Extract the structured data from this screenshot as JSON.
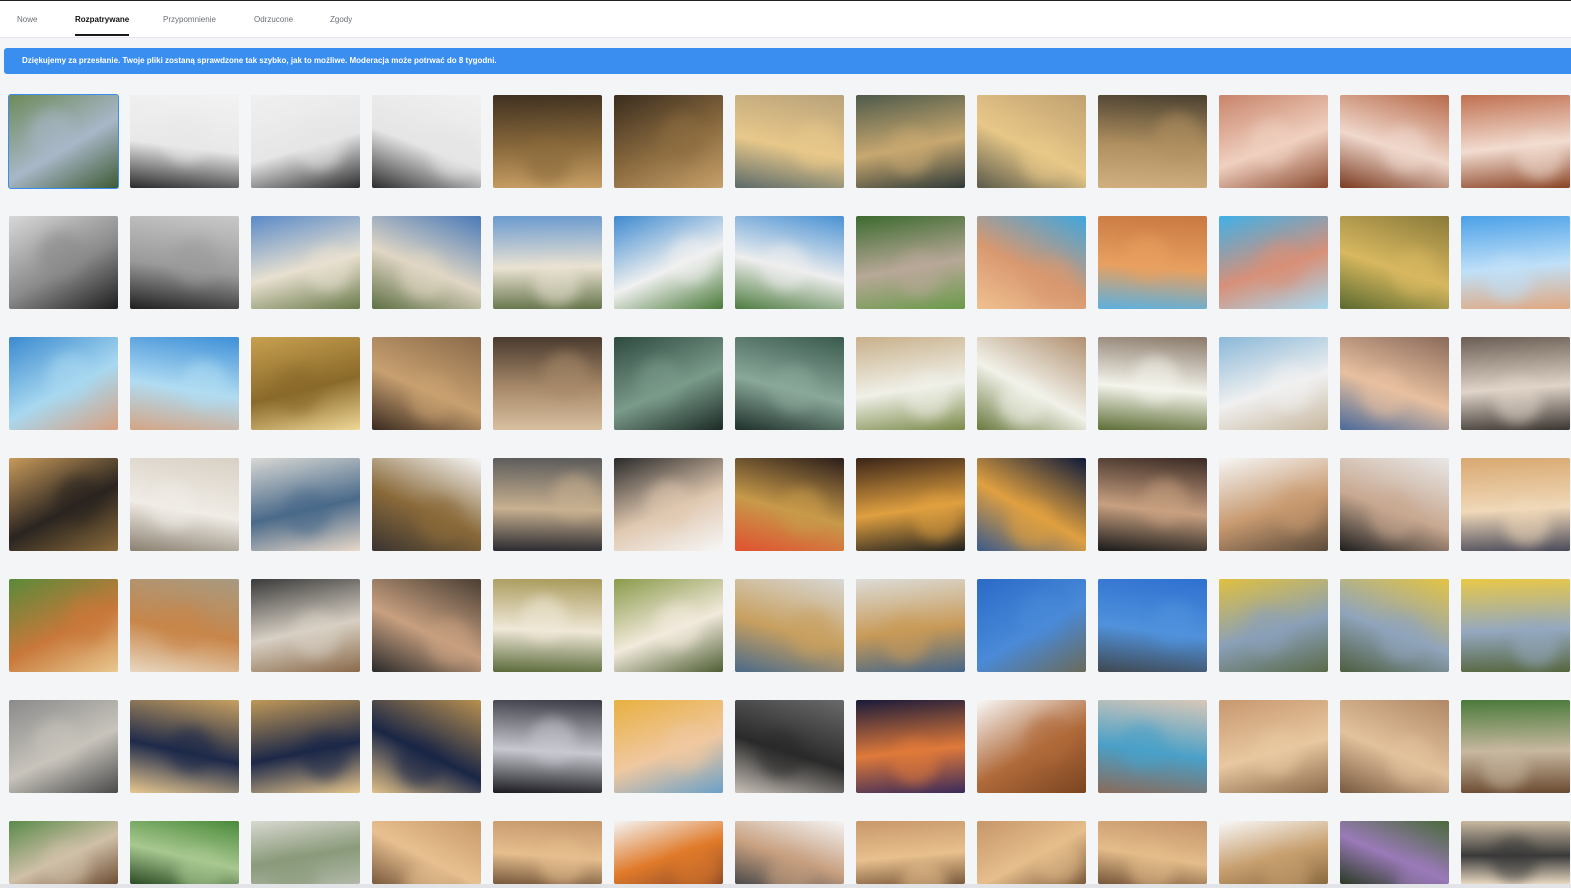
{
  "tabs": [
    {
      "label": "Nowe",
      "active": false
    },
    {
      "label": "Rozpatrywane",
      "active": true
    },
    {
      "label": "Przypomnienie",
      "active": false
    },
    {
      "label": "Odrzucone",
      "active": false
    },
    {
      "label": "Zgody",
      "active": false
    }
  ],
  "banner": {
    "text": "Dziękujemy za przesłanie. Twoje pliki zostaną sprawdzone tak szybko, jak to możliwe. Moderacja może potrwać do 8 tygodni.",
    "color": "#3a8ef0"
  },
  "selected_index": 0,
  "thumbnails": [
    {
      "subject": "older man drinking water in garden",
      "colors": [
        "#6e8a5a",
        "#a8b7c8",
        "#3d5a34"
      ]
    },
    {
      "subject": "older man in white t-shirt",
      "colors": [
        "#f2f2f2",
        "#e8e8e8",
        "#2a2a2a"
      ]
    },
    {
      "subject": "older man in white t-shirt",
      "colors": [
        "#f0f0f0",
        "#e6e6e6",
        "#2b2b2b"
      ]
    },
    {
      "subject": "older man in white t-shirt",
      "colors": [
        "#f1f1f1",
        "#e5e5e5",
        "#2c2c2c"
      ]
    },
    {
      "subject": "child planting seedling",
      "colors": [
        "#3f3020",
        "#8a6a3c",
        "#c9a066"
      ]
    },
    {
      "subject": "child planting seedling",
      "colors": [
        "#3a2c1e",
        "#8c6c40",
        "#c7a06a"
      ]
    },
    {
      "subject": "holding hands at sunset",
      "colors": [
        "#b9a27a",
        "#e8c88a",
        "#5a6a6a"
      ]
    },
    {
      "subject": "holding hands at sunset",
      "colors": [
        "#4e5a4a",
        "#c8a870",
        "#2e3a38"
      ]
    },
    {
      "subject": "holding hands at sunset",
      "colors": [
        "#c0a070",
        "#e8c888",
        "#5a5a4a"
      ]
    },
    {
      "subject": "holding hands at sunset",
      "colors": [
        "#4a4030",
        "#b09060",
        "#d0b080"
      ]
    },
    {
      "subject": "woman blowing kiss",
      "colors": [
        "#c8846a",
        "#f0d0c0",
        "#8a4a30"
      ]
    },
    {
      "subject": "woman blowing kiss",
      "colors": [
        "#b86a4a",
        "#f0d8cc",
        "#7a3a20"
      ]
    },
    {
      "subject": "woman blowing kiss",
      "colors": [
        "#c07050",
        "#f2dcd0",
        "#8a4426"
      ]
    },
    {
      "subject": "woman in white shirt black and white",
      "colors": [
        "#d8d8d8",
        "#8a8a8a",
        "#1e1e1e"
      ]
    },
    {
      "subject": "woman in white shirt black and white",
      "colors": [
        "#c8c8c8",
        "#9a9a9a",
        "#202020"
      ]
    },
    {
      "subject": "cotton field with flowing fabric",
      "colors": [
        "#5a8ac8",
        "#e8e0d0",
        "#6a7a4a"
      ]
    },
    {
      "subject": "cotton field with flowing fabric",
      "colors": [
        "#4a7ab8",
        "#e0d6c4",
        "#5e7044"
      ]
    },
    {
      "subject": "cotton field with flowing fabric",
      "colors": [
        "#6a9ad0",
        "#eae2d2",
        "#64744a"
      ]
    },
    {
      "subject": "hand holding cotton",
      "colors": [
        "#3e8ad0",
        "#f0f0f0",
        "#4a7a3a"
      ]
    },
    {
      "subject": "hand holding cotton",
      "colors": [
        "#4a92d4",
        "#eeeeee",
        "#4e7c40"
      ]
    },
    {
      "subject": "older man drinking water outdoors",
      "colors": [
        "#3c6a2e",
        "#b8a898",
        "#6a9a4a"
      ]
    },
    {
      "subject": "woman drinking from water bottle",
      "colors": [
        "#3ea6e0",
        "#d89870",
        "#f0c090"
      ]
    },
    {
      "subject": "woman drinking from water bottle",
      "colors": [
        "#c87840",
        "#e8a060",
        "#5ab0e0"
      ]
    },
    {
      "subject": "woman drinking from water bottle",
      "colors": [
        "#40b0e8",
        "#d89078",
        "#a8d8f0"
      ]
    },
    {
      "subject": "woman drinking water in field",
      "colors": [
        "#8a7a3a",
        "#d8b860",
        "#5a6a2e"
      ]
    },
    {
      "subject": "water pouring from bottle",
      "colors": [
        "#4aa0e8",
        "#c0e0f8",
        "#e0a880"
      ]
    },
    {
      "subject": "water splash drinking",
      "colors": [
        "#3a8ad0",
        "#a8d8f0",
        "#d8a080"
      ]
    },
    {
      "subject": "water splash drinking",
      "colors": [
        "#3e90d8",
        "#b0dcf2",
        "#d4a484"
      ]
    },
    {
      "subject": "bitcoin coins",
      "colors": [
        "#c8a050",
        "#8a6a2a",
        "#f0d898"
      ]
    },
    {
      "subject": "stressed man at laptop",
      "colors": [
        "#8a6a4a",
        "#c8a070",
        "#3a2a20"
      ]
    },
    {
      "subject": "stressed man at laptop",
      "colors": [
        "#4a3a2e",
        "#a88a6a",
        "#d8c0a0"
      ]
    },
    {
      "subject": "rowing boat on misty lake",
      "colors": [
        "#2e4a40",
        "#7a9a8a",
        "#1a2a24"
      ]
    },
    {
      "subject": "rowing boat on misty lake",
      "colors": [
        "#3a5a4e",
        "#8aa89a",
        "#1e302a"
      ]
    },
    {
      "subject": "child with daisy bouquet",
      "colors": [
        "#c8b08a",
        "#f0f0e8",
        "#7a8a4a"
      ]
    },
    {
      "subject": "child with daisy bouquet",
      "colors": [
        "#b09070",
        "#f2f2ea",
        "#6a7a3e"
      ]
    },
    {
      "subject": "child with daisy bouquet",
      "colors": [
        "#8a7a6a",
        "#f4f4ec",
        "#5e6e36"
      ]
    },
    {
      "subject": "woman with suitcase at airport",
      "colors": [
        "#8ab8d8",
        "#f0f0f0",
        "#c8b8a0"
      ]
    },
    {
      "subject": "smiling teenage girl",
      "colors": [
        "#8a6a5a",
        "#e8c0a0",
        "#4a6a9a"
      ]
    },
    {
      "subject": "woman in cozy sweater",
      "colors": [
        "#6a5e54",
        "#e0d4c8",
        "#3a3430"
      ]
    },
    {
      "subject": "cowgirl at sunset",
      "colors": [
        "#c89a5a",
        "#2a2420",
        "#8a6a3a"
      ]
    },
    {
      "subject": "woman relaxing on sofa",
      "colors": [
        "#d8d0c4",
        "#f0ece6",
        "#8a8070"
      ]
    },
    {
      "subject": "nurse talking with elderly woman",
      "colors": [
        "#d8d8d4",
        "#4a6a8a",
        "#e8d8c8"
      ]
    },
    {
      "subject": "yorkshire terrier with food bowl",
      "colors": [
        "#f6f6f6",
        "#8a6a3a",
        "#3a3430"
      ]
    },
    {
      "subject": "couple hugging at airport",
      "colors": [
        "#5a5a5a",
        "#c8b090",
        "#2a2a30"
      ]
    },
    {
      "subject": "couple with microphone",
      "colors": [
        "#2a2a2a",
        "#e0c8b0",
        "#f6f6f6"
      ]
    },
    {
      "subject": "man laughing in casino",
      "colors": [
        "#2a1e1a",
        "#c89a4a",
        "#e05030"
      ]
    },
    {
      "subject": "man laughing in casino",
      "colors": [
        "#3a2418",
        "#e0a040",
        "#202020"
      ]
    },
    {
      "subject": "couple overlooking city at night",
      "colors": [
        "#0e1a3a",
        "#e0a040",
        "#3a5a8a"
      ]
    },
    {
      "subject": "woman on phone call",
      "colors": [
        "#3a2a24",
        "#c8a080",
        "#1a1a1a"
      ]
    },
    {
      "subject": "smiling woman with backpack",
      "colors": [
        "#f6f6f6",
        "#c89a70",
        "#5a4a3a"
      ]
    },
    {
      "subject": "woman on phone",
      "colors": [
        "#e8e8e8",
        "#c8a890",
        "#1e1e1e"
      ]
    },
    {
      "subject": "smiling girl with earphones",
      "colors": [
        "#d8a870",
        "#f0d8b8",
        "#4a4a5a"
      ]
    },
    {
      "subject": "dog running with tennis ball",
      "colors": [
        "#5a8a3a",
        "#c8783a",
        "#e8c890"
      ]
    },
    {
      "subject": "woman hugging dog",
      "colors": [
        "#a89a80",
        "#c8864a",
        "#e8d8c0"
      ]
    },
    {
      "subject": "cowboy playing guitar on porch",
      "colors": [
        "#3a3a3a",
        "#d8d0c4",
        "#8a6a4a"
      ]
    },
    {
      "subject": "cowboy playing guitar on porch",
      "colors": [
        "#4a3e34",
        "#c8a080",
        "#2a2a2a"
      ]
    },
    {
      "subject": "family sitting in meadow",
      "colors": [
        "#a89a5a",
        "#f0e8d8",
        "#5a6a3a"
      ]
    },
    {
      "subject": "family sitting in meadow",
      "colors": [
        "#8a9a4a",
        "#f2eadc",
        "#4e5e34"
      ]
    },
    {
      "subject": "vet examining dog",
      "colors": [
        "#d8d8d4",
        "#c8a060",
        "#4a6a8a"
      ]
    },
    {
      "subject": "vet examining dog",
      "colors": [
        "#dcdcd8",
        "#c89a58",
        "#466688"
      ]
    },
    {
      "subject": "technician on tower",
      "colors": [
        "#2a6ac8",
        "#4a8ad8",
        "#6a6a5a"
      ]
    },
    {
      "subject": "technician on tower",
      "colors": [
        "#2e70d0",
        "#5092dc",
        "#404850"
      ]
    },
    {
      "subject": "woman sitting among tulips",
      "colors": [
        "#e0c040",
        "#8aa0b8",
        "#5a6a4a"
      ]
    },
    {
      "subject": "woman sitting among tulips",
      "colors": [
        "#e4c444",
        "#90a4bc",
        "#4e5e40"
      ]
    },
    {
      "subject": "woman sitting among tulips",
      "colors": [
        "#e8c848",
        "#94a8c0",
        "#56663e"
      ]
    },
    {
      "subject": "wolf among sheep",
      "colors": [
        "#8a8a8a",
        "#c8c4bc",
        "#4a4a4a"
      ]
    },
    {
      "subject": "girl in suit walking in field",
      "colors": [
        "#c8a060",
        "#1e2a4a",
        "#e8c890"
      ]
    },
    {
      "subject": "girl in suit walking in field",
      "colors": [
        "#c09858",
        "#1c2848",
        "#e4c48c"
      ]
    },
    {
      "subject": "girl in suit walking in field",
      "colors": [
        "#b89050",
        "#1a2646",
        "#e0c088"
      ]
    },
    {
      "subject": "sequined gown on runway",
      "colors": [
        "#3a3a44",
        "#c8c8d0",
        "#1a1a20"
      ]
    },
    {
      "subject": "smiling girl portrait",
      "colors": [
        "#e8b040",
        "#f0c8a0",
        "#6aa0c8"
      ]
    },
    {
      "subject": "group of teens",
      "colors": [
        "#6a6a6a",
        "#2a2a2a",
        "#c8c0b8"
      ]
    },
    {
      "subject": "milky way over palm trees",
      "colors": [
        "#1a1a3a",
        "#e07a3a",
        "#3a2a5a"
      ]
    },
    {
      "subject": "caramel candies",
      "colors": [
        "#f8f8f8",
        "#b06a3a",
        "#7a4420"
      ]
    },
    {
      "subject": "woman vlogging",
      "colors": [
        "#d8c8b8",
        "#4aa0c8",
        "#8a6a5a"
      ]
    },
    {
      "subject": "girl in flowing dress in field",
      "colors": [
        "#c89870",
        "#e8c8a0",
        "#8a6a4a"
      ]
    },
    {
      "subject": "girl in flowing dress in field",
      "colors": [
        "#b08866",
        "#e2c29c",
        "#7a5a40"
      ]
    },
    {
      "subject": "room with large windows",
      "colors": [
        "#4a7a3a",
        "#c8b8a0",
        "#6a4a30"
      ]
    },
    {
      "subject": "room with large windows",
      "colors": [
        "#5a8a4a",
        "#d0c0a8",
        "#6e4e34"
      ]
    },
    {
      "subject": "man sitting under tree",
      "colors": [
        "#4a8a3a",
        "#a8c890",
        "#2a4a24"
      ]
    },
    {
      "subject": "deer in misty meadow",
      "colors": [
        "#d8d8d0",
        "#8a9a7a",
        "#b0b8a8"
      ]
    },
    {
      "subject": "girl in field at sunset",
      "colors": [
        "#c89a6a",
        "#e8c090",
        "#7a5a3e"
      ]
    },
    {
      "subject": "girl in field at sunset",
      "colors": [
        "#c4966a",
        "#e6be8e",
        "#76583c"
      ]
    },
    {
      "subject": "woman in orange sari",
      "colors": [
        "#f4f4f4",
        "#e07a2a",
        "#8a4a2a"
      ]
    },
    {
      "subject": "illustrated mother and child",
      "colors": [
        "#f4f4f4",
        "#c8a080",
        "#4a4a4a"
      ]
    },
    {
      "subject": "girl in field at sunset",
      "colors": [
        "#c8986a",
        "#e8c08e",
        "#7a5a3c"
      ]
    },
    {
      "subject": "girl in field at sunset",
      "colors": [
        "#c6966a",
        "#e6be8c",
        "#78583a"
      ]
    },
    {
      "subject": "girl in field at sunset",
      "colors": [
        "#c4946a",
        "#e4bc8a",
        "#76563a"
      ]
    },
    {
      "subject": "stack of cardboard boxes",
      "colors": [
        "#f8f8f8",
        "#c8a070",
        "#8a6a40"
      ]
    },
    {
      "subject": "garden path to cottage",
      "colors": [
        "#4a6a3a",
        "#9a7ab8",
        "#2a3a24"
      ]
    },
    {
      "subject": "group in front of building",
      "colors": [
        "#c8b8a0",
        "#3a3a3a",
        "#e8d8c0"
      ]
    }
  ]
}
